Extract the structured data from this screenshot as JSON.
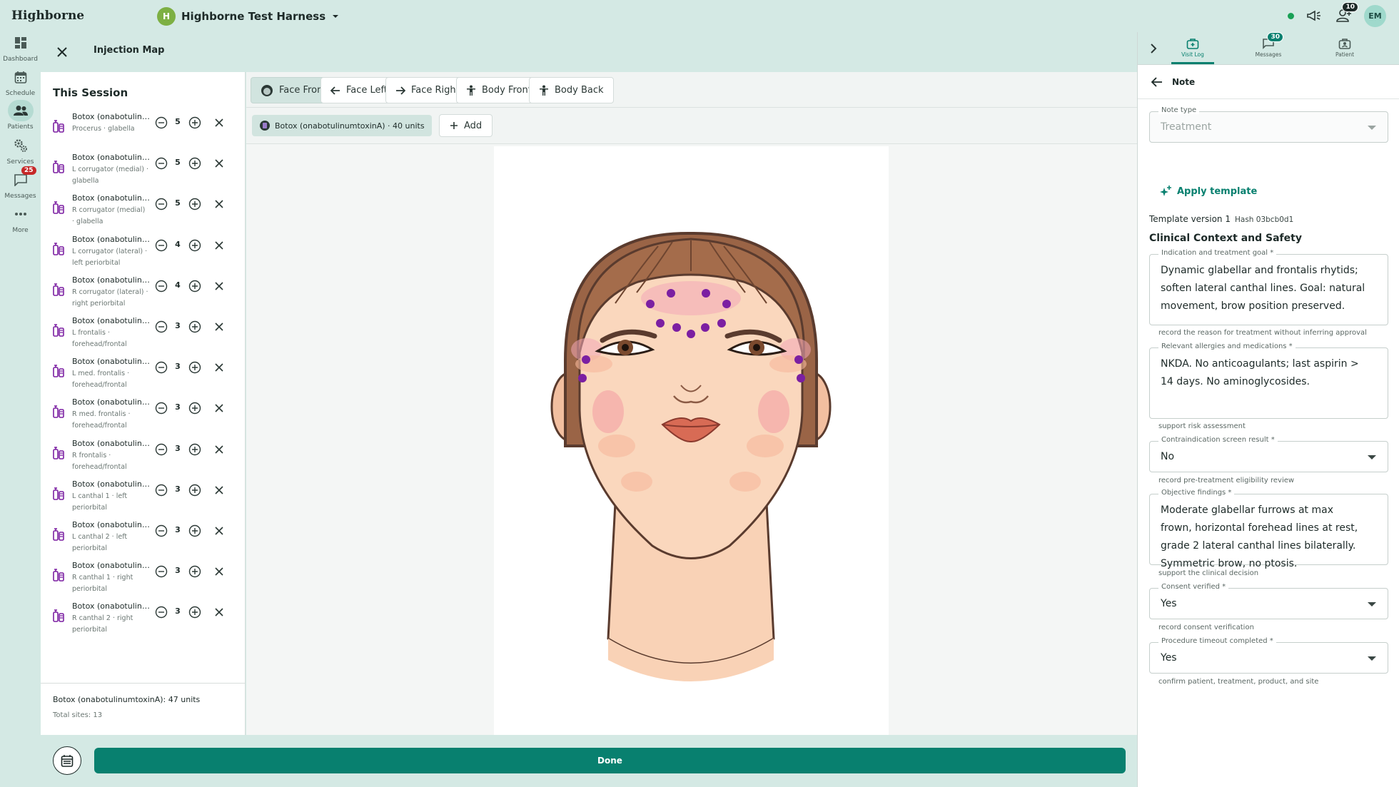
{
  "app": {
    "brand": "Highborne",
    "org_initial": "H",
    "org_name": "Highborne Test Harness",
    "notifications_count": "10",
    "user_initials": "EM"
  },
  "rail": {
    "items": [
      {
        "label": "Dashboard",
        "icon": "dashboard-icon"
      },
      {
        "label": "Schedule",
        "icon": "calendar-icon"
      },
      {
        "label": "Patients",
        "icon": "people-icon"
      },
      {
        "label": "Services",
        "icon": "gears-icon"
      },
      {
        "label": "Messages",
        "icon": "chat-icon",
        "badge": "25"
      },
      {
        "label": "More",
        "icon": "more-icon"
      }
    ]
  },
  "workspace": {
    "title": "Injection Map",
    "session_title": "This Session",
    "injections": [
      {
        "name": "Botox (onabotulinumtoxinA)",
        "site": "Procerus · glabella",
        "qty": "5"
      },
      {
        "name": "Botox (onabotulinumtoxinA)",
        "site": "L corrugator (medial) · glabella",
        "qty": "5"
      },
      {
        "name": "Botox (onabotulinumtoxinA)",
        "site": "R corrugator (medial) · glabella",
        "qty": "5"
      },
      {
        "name": "Botox (onabotulinumtoxinA)",
        "site": "L corrugator (lateral) · left periorbital",
        "qty": "4"
      },
      {
        "name": "Botox (onabotulinumtoxinA)",
        "site": "R corrugator (lateral) · right periorbital",
        "qty": "4"
      },
      {
        "name": "Botox (onabotulinumtoxinA)",
        "site": "L frontalis · forehead/frontal",
        "qty": "3"
      },
      {
        "name": "Botox (onabotulinumtoxinA)",
        "site": "L med. frontalis · forehead/frontal",
        "qty": "3"
      },
      {
        "name": "Botox (onabotulinumtoxinA)",
        "site": "R med. frontalis · forehead/frontal",
        "qty": "3"
      },
      {
        "name": "Botox (onabotulinumtoxinA)",
        "site": "R frontalis · forehead/frontal",
        "qty": "3"
      },
      {
        "name": "Botox (onabotulinumtoxinA)",
        "site": "L canthal 1 · left periorbital",
        "qty": "3"
      },
      {
        "name": "Botox (onabotulinumtoxinA)",
        "site": "L canthal 2 · left periorbital",
        "qty": "3"
      },
      {
        "name": "Botox (onabotulinumtoxinA)",
        "site": "R canthal 1 · right periorbital",
        "qty": "3"
      },
      {
        "name": "Botox (onabotulinumtoxinA)",
        "site": "R canthal 2 · right periorbital",
        "qty": "3"
      }
    ],
    "summary_total": "Botox (onabotulinumtoxinA): 47 units",
    "summary_sites": "Total sites: 13",
    "view_tabs": [
      "Face Front",
      "Face Left",
      "Face Right",
      "Body Front",
      "Body Back"
    ],
    "product_chip": "Botox (onabotulinumtoxinA) · 40 units",
    "add_label": "Add",
    "done_label": "Done",
    "marker_color": "#7b1fa2"
  },
  "panel": {
    "tabs": [
      {
        "label": "Visit Log",
        "icon": "medical-bag-icon"
      },
      {
        "label": "Messages",
        "icon": "chat-icon",
        "badge": "30"
      },
      {
        "label": "Patient",
        "icon": "patient-card-icon"
      }
    ],
    "note_title": "Note",
    "note_type_label": "Note type",
    "note_type_value": "Treatment",
    "apply_template": "Apply template",
    "template_version": "Template version 1",
    "template_hash": "Hash 03bcb0d1",
    "section_title": "Clinical Context and Safety",
    "fields": {
      "indication": {
        "label": "Indication and treatment goal *",
        "value": "Dynamic glabellar and frontalis rhytids;\nsoften lateral canthal lines. Goal: natural\nmovement, brow position preserved.",
        "help": "record the reason for treatment without inferring approval"
      },
      "allergies": {
        "label": "Relevant allergies and medications *",
        "value": "NKDA. No anticoagulants; last aspirin >\n14 days. No aminoglycosides.",
        "help": "support risk assessment"
      },
      "contraindication": {
        "label": "Contraindication screen result *",
        "value": "No",
        "help": "record pre-treatment eligibility review"
      },
      "objective": {
        "label": "Objective findings *",
        "value": "Moderate glabellar furrows at max\nfrown, horizontal forehead lines at rest,\ngrade 2 lateral canthal lines bilaterally.\nSymmetric brow, no ptosis.",
        "help": "support the clinical decision"
      },
      "consent": {
        "label": "Consent verified *",
        "value": "Yes",
        "help": "record consent verification"
      },
      "timeout": {
        "label": "Procedure timeout completed *",
        "value": "Yes",
        "help": "confirm patient, treatment, product, and site"
      }
    }
  }
}
